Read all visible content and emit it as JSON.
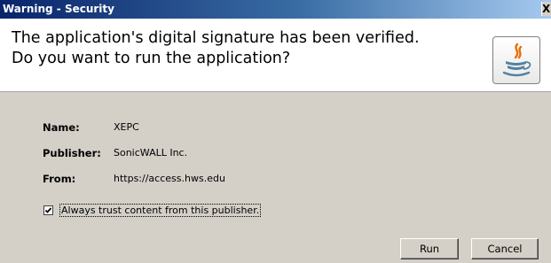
{
  "window": {
    "title": "Warning - Security",
    "close_symbol": "X"
  },
  "header": {
    "line1": "The application's digital signature has been verified.",
    "line2": "Do you want to run the application?",
    "icon": "java-cup-icon"
  },
  "details": [
    {
      "label": "Name:",
      "value": "XEPC"
    },
    {
      "label": "Publisher:",
      "value": "SonicWALL Inc."
    },
    {
      "label": "From:",
      "value": "https://access.hws.edu"
    }
  ],
  "trust_checkbox": {
    "label": "Always trust content from this publisher.",
    "checked": true
  },
  "buttons": {
    "run": "Run",
    "cancel": "Cancel"
  },
  "colors": {
    "titlebar_start": "#0a246a",
    "titlebar_end": "#a6caf0",
    "dialog_bg": "#d4d0c8",
    "java_orange": "#e76f00",
    "java_blue": "#5382a1"
  }
}
